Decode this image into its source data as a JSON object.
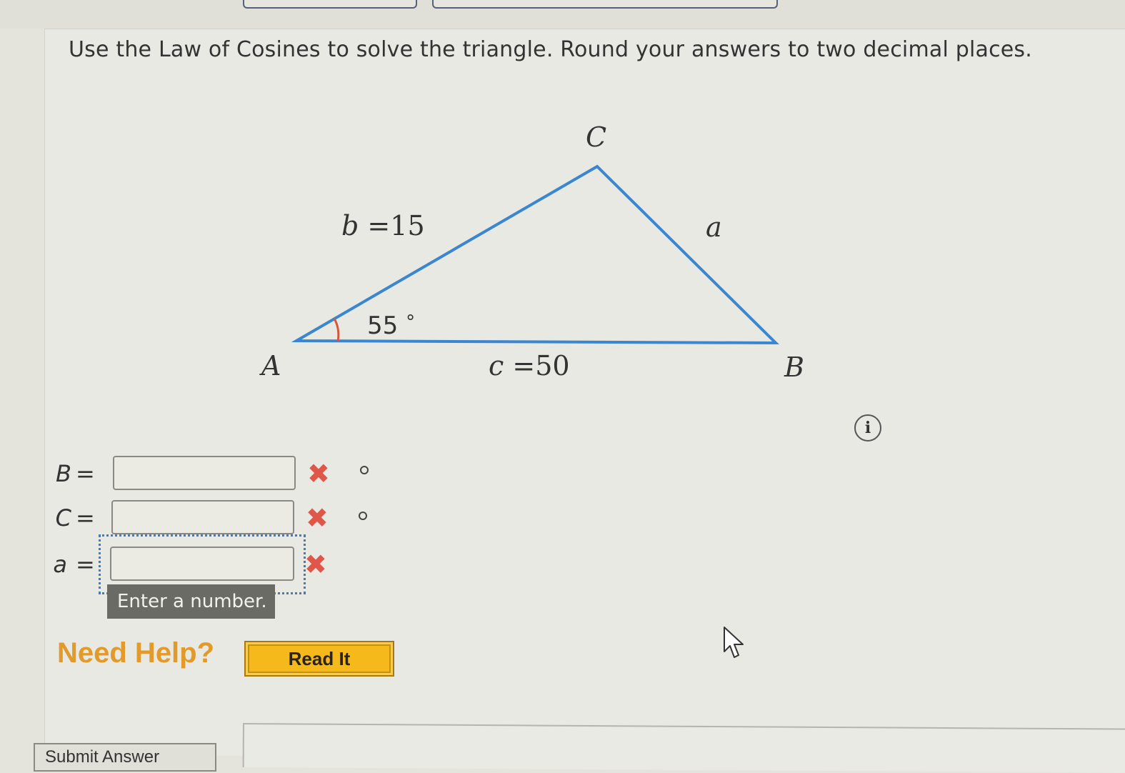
{
  "top_tabs": [
    {
      "label": ""
    },
    {
      "label": ""
    }
  ],
  "question": {
    "instruction": "Use the Law of Cosines to solve the triangle. Round your answers to two decimal places."
  },
  "figure": {
    "vertices": {
      "A": "A",
      "B": "B",
      "C": "C"
    },
    "side_b": {
      "var": "b",
      "eq": "=",
      "value": "15"
    },
    "side_c": {
      "var": "c",
      "eq": "=",
      "value": "50"
    },
    "side_a": {
      "var": "a"
    },
    "angle_A": {
      "value": "55",
      "unit": "°"
    },
    "colors": {
      "triangle_stroke": "#3a86d0",
      "angle_arc": "#d6573a"
    }
  },
  "info_icon": {
    "glyph": "i"
  },
  "answers": [
    {
      "var": "B",
      "eq": "=",
      "value": "",
      "status": "incorrect",
      "status_glyph": "✖",
      "unit": "degree"
    },
    {
      "var": "C",
      "eq": "=",
      "value": "",
      "status": "incorrect",
      "status_glyph": "✖",
      "unit": "degree"
    },
    {
      "var": "a",
      "eq": "=",
      "value": "",
      "status": "incorrect",
      "status_glyph": "✖",
      "unit": ""
    }
  ],
  "tooltip": {
    "text": "Enter a number."
  },
  "help": {
    "label": "Need Help?",
    "read_it_label": "Read It"
  },
  "submit": {
    "label": "Submit Answer"
  }
}
